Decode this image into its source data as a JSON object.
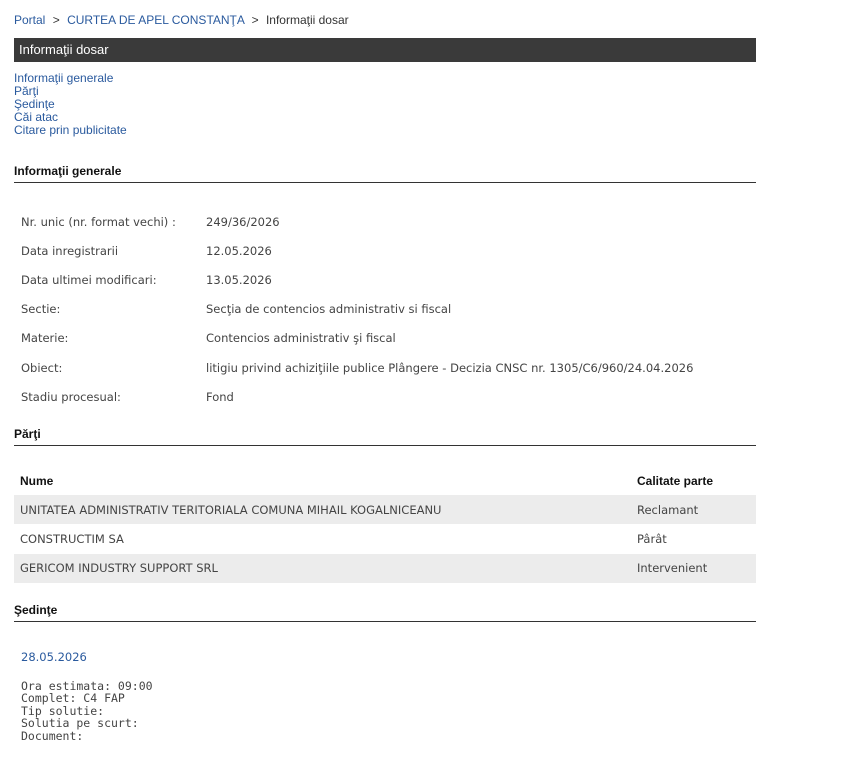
{
  "breadcrumb": {
    "portal": "Portal",
    "court": "CURTEA DE APEL CONSTANŢA",
    "current": "Informaţii dosar",
    "separator": ">"
  },
  "page_title": "Informaţii dosar",
  "toc": [
    "Informaţii generale",
    "Părţi",
    "Şedinţe",
    "Căi atac",
    "Citare prin publicitate"
  ],
  "general": {
    "header": "Informaţii generale",
    "rows": [
      {
        "label": "Nr. unic (nr. format vechi) :",
        "value": "249/36/2026"
      },
      {
        "label": "Data inregistrarii",
        "value": "12.05.2026"
      },
      {
        "label": "Data ultimei modificari:",
        "value": "13.05.2026"
      },
      {
        "label": "Sectie:",
        "value": "Secţia de contencios administrativ si fiscal"
      },
      {
        "label": "Materie:",
        "value": "Contencios administrativ şi fiscal"
      },
      {
        "label": "Obiect:",
        "value": "litigiu privind achiziţiile publice Plângere - Decizia CNSC nr. 1305/C6/960/24.04.2026"
      },
      {
        "label": "Stadiu procesual:",
        "value": "Fond"
      }
    ]
  },
  "parti": {
    "header": "Părţi",
    "columns": [
      "Nume",
      "Calitate parte"
    ],
    "rows": [
      {
        "nume": "UNITATEA ADMINISTRATIV TERITORIALA COMUNA MIHAIL KOGALNICEANU",
        "calitate": "Reclamant"
      },
      {
        "nume": "CONSTRUCTIM SA",
        "calitate": "Pârât"
      },
      {
        "nume": "GERICOM INDUSTRY SUPPORT SRL",
        "calitate": "Intervenient"
      }
    ]
  },
  "sedinte": {
    "header": "Şedinţe",
    "date": "28.05.2026",
    "details": [
      "Ora estimata: 09:00",
      "Complet: C4 FAP",
      "Tip solutie:",
      "Solutia pe scurt:",
      "Document:"
    ]
  },
  "colors": {
    "link": "#2a5a9e",
    "title_bar": "#3a3a3a",
    "row_shade": "#ececec"
  }
}
